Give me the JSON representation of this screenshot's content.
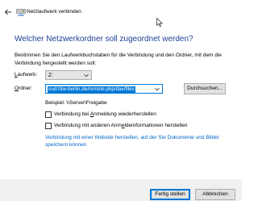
{
  "window": {
    "title": "Netzlaufwerk verbinden"
  },
  "main": {
    "heading": "Welcher Netzwerkordner soll zugeordnet werden?",
    "description": "Bestimmen Sie den Laufwerkbuchstaben für die Verbindung und den Ordner, mit dem die Verbindung hergestellt werden soll:",
    "drive": {
      "label_prefix": "L",
      "label_rest": "aufwerk:",
      "value": "Z:"
    },
    "folder": {
      "label_prefix": "O",
      "label_rest": "rdner:",
      "value": "oud.htw-berlin.de/remote.php/dav/files"
    },
    "browse_label": "Durchsuchen...",
    "example": "Beispiel: \\\\Server\\Freigabe",
    "checkbox_reconnect": {
      "label_before": "Verbindung bei ",
      "label_underlined": "A",
      "label_after": "nmeldung wiederherstellen",
      "checked": false
    },
    "checkbox_credentials": {
      "label_before": "Verbindung mit anderen Anm",
      "label_underlined": "e",
      "label_after": "ldeinformationen herstellen",
      "checked": false
    },
    "link_text": "Verbindung mit einer Website herstellen, auf der Sie Dokumente und Bilder speichern können"
  },
  "footer": {
    "finish_label": "Fertig stellen",
    "cancel_label": "Abbrechen"
  },
  "colors": {
    "heading": "#1f3f9a",
    "link": "#0066cc",
    "accent": "#0078d7"
  }
}
